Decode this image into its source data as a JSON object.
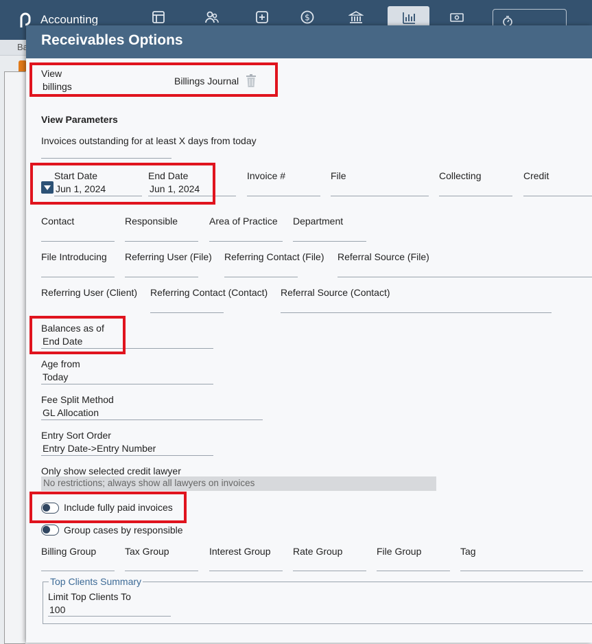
{
  "app": {
    "title": "Accounting",
    "nav_icons": [
      "layout-icon",
      "users-icon",
      "plus-box-icon",
      "dollar-icon",
      "bank-icon",
      "chart-icon",
      "money-icon",
      "timer-icon"
    ],
    "subbar_text": "Ba"
  },
  "dialog": {
    "title": "Receivables Options",
    "view": {
      "label": "View",
      "value": "billings",
      "report_name": "Billings Journal"
    },
    "view_parameters": {
      "heading": "View Parameters",
      "days_outstanding_label": "Invoices outstanding for at least X days from today",
      "start_date": {
        "label": "Start Date",
        "value": "Jun 1, 2024"
      },
      "end_date": {
        "label": "End Date",
        "value": "Jun 1, 2024"
      },
      "row1_fields": [
        "Invoice #",
        "File",
        "Collecting",
        "Credit"
      ],
      "row2_fields": [
        "Contact",
        "Responsible",
        "Area of Practice",
        "Department"
      ],
      "row3_fields": [
        "File Introducing",
        "Referring User (File)",
        "Referring Contact (File)",
        "Referral Source (File)"
      ],
      "row4_fields": [
        "Referring User (Client)",
        "Referring Contact (Contact)",
        "Referral Source (Contact)"
      ],
      "balances_as_of": {
        "label": "Balances as of",
        "value": "End Date"
      },
      "age_from": {
        "label": "Age from",
        "value": "Today"
      },
      "fee_split": {
        "label": "Fee Split Method",
        "value": "GL Allocation"
      },
      "entry_sort": {
        "label": "Entry Sort Order",
        "value": "Entry Date->Entry Number"
      },
      "credit_lawyer": {
        "label": "Only show selected credit lawyer",
        "value": "No restrictions; always show all lawyers on invoices"
      },
      "toggle_paid": {
        "label": "Include fully paid invoices",
        "on": false
      },
      "toggle_group": {
        "label": "Group cases by responsible",
        "on": false
      },
      "row5_fields": [
        "Billing Group",
        "Tax Group",
        "Interest Group",
        "Rate Group",
        "File Group",
        "Tag"
      ],
      "top_clients": {
        "legend": "Top Clients Summary",
        "limit_label": "Limit Top Clients To",
        "limit_value": "100"
      }
    }
  },
  "colors": {
    "appbar": "#34526f",
    "dialog_header": "#476785",
    "highlight": "#e0141e",
    "accent": "#3c6a96"
  }
}
